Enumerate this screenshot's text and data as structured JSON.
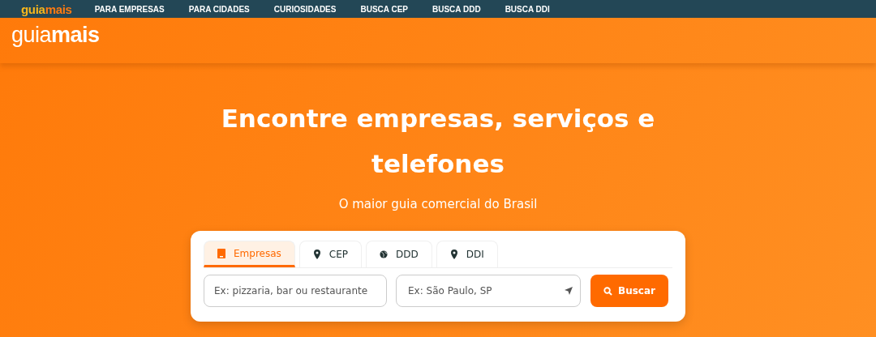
{
  "top_bar": {
    "logo": {
      "first": "guia",
      "second": "mais"
    },
    "links": [
      "PARA EMPRESAS",
      "PARA CIDADES",
      "CURIOSIDADES",
      "BUSCA CEP",
      "BUSCA DDD",
      "BUSCA DDI"
    ]
  },
  "header": {
    "logo": {
      "first": "guia",
      "second": "mais"
    }
  },
  "hero": {
    "title": "Encontre empresas, serviços e telefones",
    "subtitle": "O maior guia comercial do Brasil"
  },
  "search": {
    "tabs": [
      {
        "label": "Empresas",
        "kind": "building",
        "selected": true
      },
      {
        "label": "CEP",
        "kind": "pin",
        "selected": false
      },
      {
        "label": "DDD",
        "kind": "globe",
        "selected": false
      },
      {
        "label": "DDI",
        "kind": "pin",
        "selected": false
      }
    ],
    "what": {
      "placeholder": "Ex: pizzaria, bar ou restaurante"
    },
    "where": {
      "placeholder": "Ex: São Paulo, SP"
    },
    "button": "Buscar"
  }
}
